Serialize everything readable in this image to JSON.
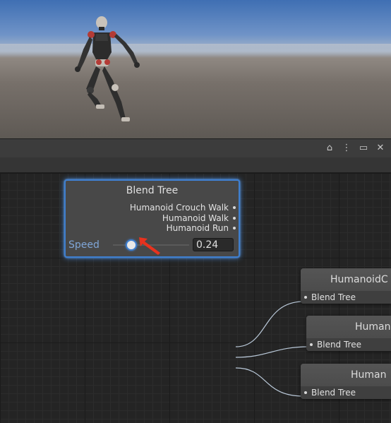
{
  "window": {
    "title_actions": [
      "lock-icon",
      "more-icon",
      "maximize-icon",
      "close-icon"
    ],
    "glyphs": {
      "lock": "⌂",
      "more": "⋮",
      "maximize": "▭",
      "close": "✕"
    }
  },
  "blend_tree": {
    "title": "Blend Tree",
    "outputs": [
      "Humanoid Crouch Walk",
      "Humanoid Walk",
      "Humanoid Run"
    ],
    "parameter": {
      "label": "Speed",
      "value": "0.24",
      "slider_fraction": 0.24
    }
  },
  "child_nodes": [
    {
      "title": "HumanoidC",
      "port": "Blend Tree"
    },
    {
      "title": "Human",
      "port": "Blend Tree"
    },
    {
      "title": "Human",
      "port": "Blend Tree"
    }
  ],
  "colors": {
    "selection": "#3f7fcf",
    "parameter_label": "#7fa6d8",
    "annotation_arrow": "#e8321e",
    "wire": "#b9c8d8"
  }
}
